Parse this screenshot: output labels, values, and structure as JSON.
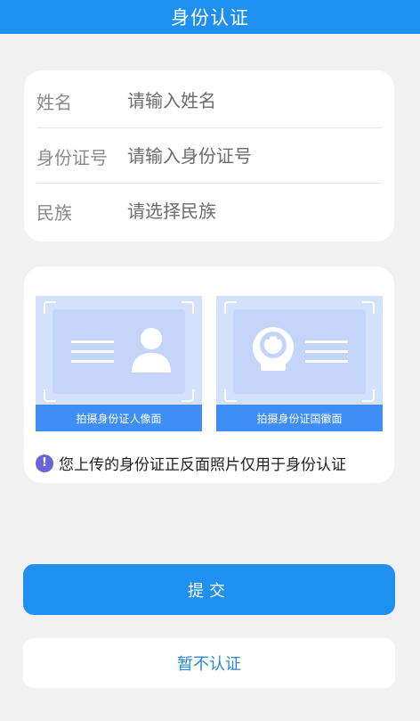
{
  "header": {
    "title": "身份认证"
  },
  "form": {
    "name": {
      "label": "姓名",
      "placeholder": "请输入姓名"
    },
    "id_number": {
      "label": "身份证号",
      "placeholder": "请输入身份证号"
    },
    "ethnicity": {
      "label": "民族",
      "placeholder": "请选择民族"
    }
  },
  "upload": {
    "front_label": "拍摄身份证人像面",
    "back_label": "拍摄身份证国徽面",
    "tip_icon": "!",
    "tip_text": "您上传的身份证正反面照片仅用于身份认证"
  },
  "buttons": {
    "submit": "提交",
    "skip": "暂不认证"
  },
  "colors": {
    "primary": "#1f8ff0",
    "tile_bg": "#d4e1fc",
    "tile_bar": "#3f8ef5",
    "tip_icon": "#6b63d8"
  }
}
